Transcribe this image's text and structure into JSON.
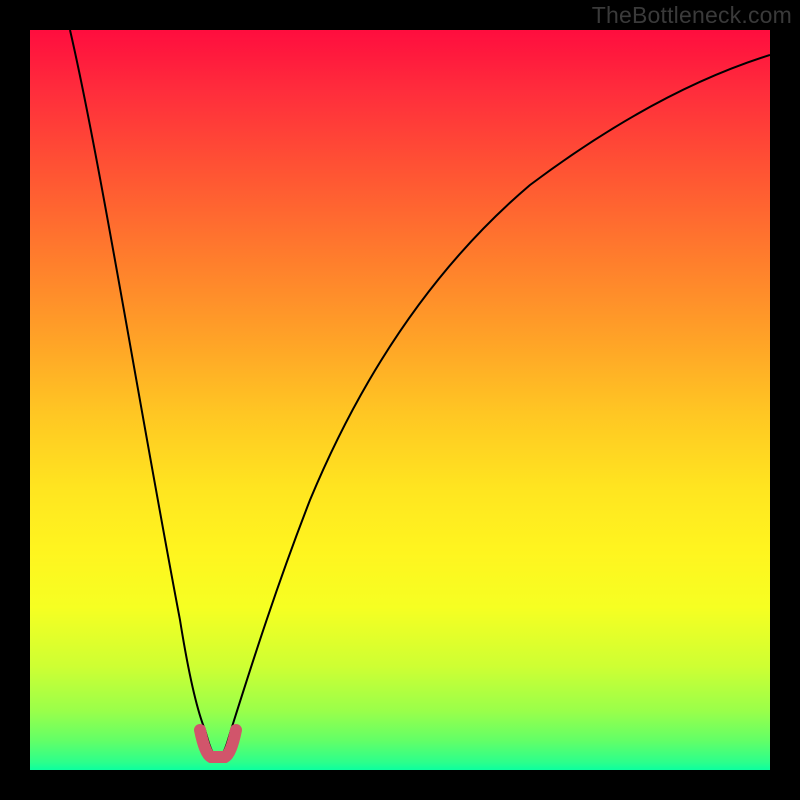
{
  "watermark": {
    "text": "TheBottleneck.com"
  },
  "chart_data": {
    "type": "line",
    "title": "",
    "xlabel": "",
    "ylabel": "",
    "xlim": [
      0,
      100
    ],
    "ylim": [
      0,
      100
    ],
    "grid": false,
    "legend": false,
    "background_gradient": {
      "direction": "vertical",
      "stops": [
        {
          "pos": 0,
          "meaning": "worst / 100%",
          "color": "#ff0d3e"
        },
        {
          "pos": 50,
          "meaning": "mid",
          "color": "#ffc723"
        },
        {
          "pos": 100,
          "meaning": "best / 0%",
          "color": "#0cffa0"
        }
      ]
    },
    "series": [
      {
        "name": "bottleneck-curve",
        "color": "#000000",
        "stroke_width": 2,
        "x": [
          0,
          3,
          6,
          9,
          12,
          15,
          18,
          20,
          21,
          22,
          23,
          24,
          25,
          26,
          27,
          28,
          29,
          30,
          32,
          35,
          38,
          42,
          46,
          52,
          60,
          70,
          82,
          95,
          100
        ],
        "y": [
          100,
          87,
          74,
          61,
          49,
          37,
          25,
          16,
          11,
          6,
          3,
          1,
          0,
          0,
          1,
          3,
          7,
          12,
          22,
          34,
          44,
          54,
          62,
          70,
          78,
          85,
          91,
          96,
          98
        ]
      },
      {
        "name": "min-marker",
        "color": "#d1556b",
        "stroke_width": 12,
        "linecap": "round",
        "x": [
          22.5,
          23.5,
          24.0,
          25.0,
          26.0,
          26.5,
          27.5
        ],
        "y": [
          4.0,
          1.5,
          0.8,
          0.6,
          0.8,
          1.5,
          4.0
        ]
      }
    ],
    "bottleneck_min": {
      "x": 25,
      "y": 0
    }
  }
}
